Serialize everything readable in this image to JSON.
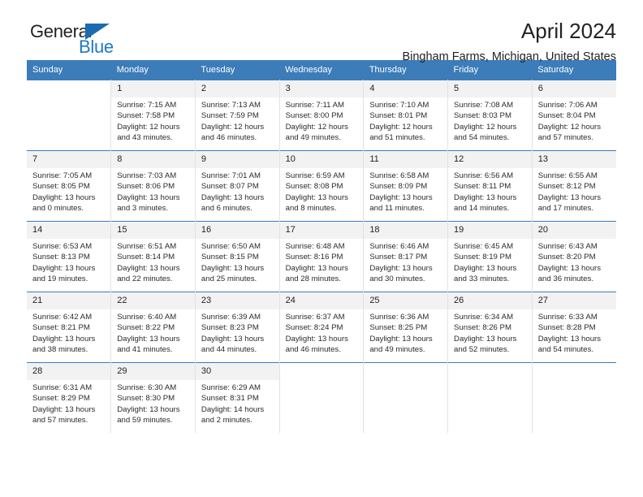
{
  "brand": {
    "name_part1": "General",
    "name_part2": "Blue",
    "triangle_icon": "triangle-icon"
  },
  "header": {
    "month_title": "April 2024",
    "location": "Bingham Farms, Michigan, United States"
  },
  "colors": {
    "header_blue": "#3b7cb9",
    "logo_blue": "#1b79c9",
    "daynum_band": "#f2f2f2"
  },
  "calendar": {
    "weekday_headers": [
      "Sunday",
      "Monday",
      "Tuesday",
      "Wednesday",
      "Thursday",
      "Friday",
      "Saturday"
    ],
    "weeks": [
      [
        {
          "day": "",
          "lines": []
        },
        {
          "day": "1",
          "lines": [
            "Sunrise: 7:15 AM",
            "Sunset: 7:58 PM",
            "Daylight: 12 hours",
            "and 43 minutes."
          ]
        },
        {
          "day": "2",
          "lines": [
            "Sunrise: 7:13 AM",
            "Sunset: 7:59 PM",
            "Daylight: 12 hours",
            "and 46 minutes."
          ]
        },
        {
          "day": "3",
          "lines": [
            "Sunrise: 7:11 AM",
            "Sunset: 8:00 PM",
            "Daylight: 12 hours",
            "and 49 minutes."
          ]
        },
        {
          "day": "4",
          "lines": [
            "Sunrise: 7:10 AM",
            "Sunset: 8:01 PM",
            "Daylight: 12 hours",
            "and 51 minutes."
          ]
        },
        {
          "day": "5",
          "lines": [
            "Sunrise: 7:08 AM",
            "Sunset: 8:03 PM",
            "Daylight: 12 hours",
            "and 54 minutes."
          ]
        },
        {
          "day": "6",
          "lines": [
            "Sunrise: 7:06 AM",
            "Sunset: 8:04 PM",
            "Daylight: 12 hours",
            "and 57 minutes."
          ]
        }
      ],
      [
        {
          "day": "7",
          "lines": [
            "Sunrise: 7:05 AM",
            "Sunset: 8:05 PM",
            "Daylight: 13 hours",
            "and 0 minutes."
          ]
        },
        {
          "day": "8",
          "lines": [
            "Sunrise: 7:03 AM",
            "Sunset: 8:06 PM",
            "Daylight: 13 hours",
            "and 3 minutes."
          ]
        },
        {
          "day": "9",
          "lines": [
            "Sunrise: 7:01 AM",
            "Sunset: 8:07 PM",
            "Daylight: 13 hours",
            "and 6 minutes."
          ]
        },
        {
          "day": "10",
          "lines": [
            "Sunrise: 6:59 AM",
            "Sunset: 8:08 PM",
            "Daylight: 13 hours",
            "and 8 minutes."
          ]
        },
        {
          "day": "11",
          "lines": [
            "Sunrise: 6:58 AM",
            "Sunset: 8:09 PM",
            "Daylight: 13 hours",
            "and 11 minutes."
          ]
        },
        {
          "day": "12",
          "lines": [
            "Sunrise: 6:56 AM",
            "Sunset: 8:11 PM",
            "Daylight: 13 hours",
            "and 14 minutes."
          ]
        },
        {
          "day": "13",
          "lines": [
            "Sunrise: 6:55 AM",
            "Sunset: 8:12 PM",
            "Daylight: 13 hours",
            "and 17 minutes."
          ]
        }
      ],
      [
        {
          "day": "14",
          "lines": [
            "Sunrise: 6:53 AM",
            "Sunset: 8:13 PM",
            "Daylight: 13 hours",
            "and 19 minutes."
          ]
        },
        {
          "day": "15",
          "lines": [
            "Sunrise: 6:51 AM",
            "Sunset: 8:14 PM",
            "Daylight: 13 hours",
            "and 22 minutes."
          ]
        },
        {
          "day": "16",
          "lines": [
            "Sunrise: 6:50 AM",
            "Sunset: 8:15 PM",
            "Daylight: 13 hours",
            "and 25 minutes."
          ]
        },
        {
          "day": "17",
          "lines": [
            "Sunrise: 6:48 AM",
            "Sunset: 8:16 PM",
            "Daylight: 13 hours",
            "and 28 minutes."
          ]
        },
        {
          "day": "18",
          "lines": [
            "Sunrise: 6:46 AM",
            "Sunset: 8:17 PM",
            "Daylight: 13 hours",
            "and 30 minutes."
          ]
        },
        {
          "day": "19",
          "lines": [
            "Sunrise: 6:45 AM",
            "Sunset: 8:19 PM",
            "Daylight: 13 hours",
            "and 33 minutes."
          ]
        },
        {
          "day": "20",
          "lines": [
            "Sunrise: 6:43 AM",
            "Sunset: 8:20 PM",
            "Daylight: 13 hours",
            "and 36 minutes."
          ]
        }
      ],
      [
        {
          "day": "21",
          "lines": [
            "Sunrise: 6:42 AM",
            "Sunset: 8:21 PM",
            "Daylight: 13 hours",
            "and 38 minutes."
          ]
        },
        {
          "day": "22",
          "lines": [
            "Sunrise: 6:40 AM",
            "Sunset: 8:22 PM",
            "Daylight: 13 hours",
            "and 41 minutes."
          ]
        },
        {
          "day": "23",
          "lines": [
            "Sunrise: 6:39 AM",
            "Sunset: 8:23 PM",
            "Daylight: 13 hours",
            "and 44 minutes."
          ]
        },
        {
          "day": "24",
          "lines": [
            "Sunrise: 6:37 AM",
            "Sunset: 8:24 PM",
            "Daylight: 13 hours",
            "and 46 minutes."
          ]
        },
        {
          "day": "25",
          "lines": [
            "Sunrise: 6:36 AM",
            "Sunset: 8:25 PM",
            "Daylight: 13 hours",
            "and 49 minutes."
          ]
        },
        {
          "day": "26",
          "lines": [
            "Sunrise: 6:34 AM",
            "Sunset: 8:26 PM",
            "Daylight: 13 hours",
            "and 52 minutes."
          ]
        },
        {
          "day": "27",
          "lines": [
            "Sunrise: 6:33 AM",
            "Sunset: 8:28 PM",
            "Daylight: 13 hours",
            "and 54 minutes."
          ]
        }
      ],
      [
        {
          "day": "28",
          "lines": [
            "Sunrise: 6:31 AM",
            "Sunset: 8:29 PM",
            "Daylight: 13 hours",
            "and 57 minutes."
          ]
        },
        {
          "day": "29",
          "lines": [
            "Sunrise: 6:30 AM",
            "Sunset: 8:30 PM",
            "Daylight: 13 hours",
            "and 59 minutes."
          ]
        },
        {
          "day": "30",
          "lines": [
            "Sunrise: 6:29 AM",
            "Sunset: 8:31 PM",
            "Daylight: 14 hours",
            "and 2 minutes."
          ]
        },
        {
          "day": "",
          "lines": []
        },
        {
          "day": "",
          "lines": []
        },
        {
          "day": "",
          "lines": []
        },
        {
          "day": "",
          "lines": []
        }
      ]
    ]
  }
}
